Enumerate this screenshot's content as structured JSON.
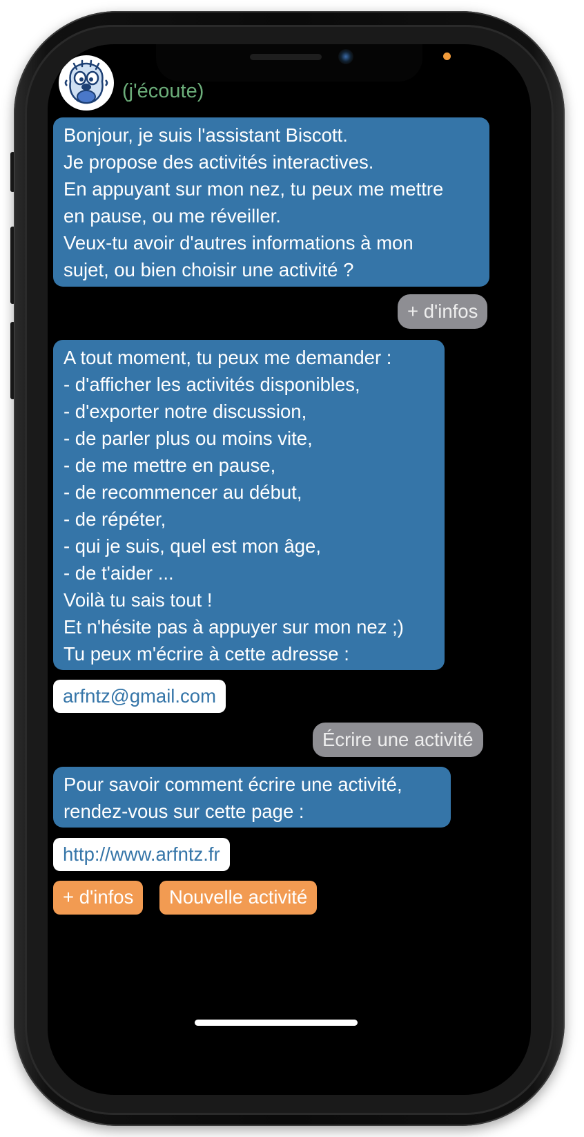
{
  "header": {
    "status": "(j'écoute)"
  },
  "messages": {
    "intro": [
      "Bonjour, je suis l'assistant Biscott.",
      "Je propose des activités interactives.",
      "En appuyant sur mon nez, tu peux me mettre",
      "en pause, ou me réveiller.",
      "Veux-tu avoir d'autres informations à mon",
      "sujet, ou bien choisir une activité ?"
    ],
    "user_infos": "+ d'infos",
    "help": [
      "A tout moment, tu peux me demander :",
      "- d'afficher les activités disponibles,",
      "- d'exporter notre discussion,",
      "- de parler plus ou moins vite,",
      "- de me mettre en pause,",
      "- de recommencer au début,",
      "- de répéter,",
      "- qui je suis, quel est mon âge,",
      "- de t'aider ...",
      "Voilà tu sais tout !",
      "Et n'hésite pas à appuyer sur mon nez ;)",
      "Tu peux m'écrire à cette adresse :"
    ],
    "email_link": "arfntz@gmail.com",
    "user_write": "Écrire une activité",
    "write_info": [
      "Pour savoir comment écrire une activité,",
      "rendez-vous sur cette page :"
    ],
    "web_link": "http://www.arfntz.fr"
  },
  "choices": {
    "more_info": "+ d'infos",
    "new_activity": "Nouvelle activité"
  },
  "colors": {
    "bot_bubble": "#3575a8",
    "user_bubble": "#8e8e93",
    "choice_button": "#f29b52",
    "status_text": "#6cae7a",
    "recording_dot": "#f29b3a"
  }
}
